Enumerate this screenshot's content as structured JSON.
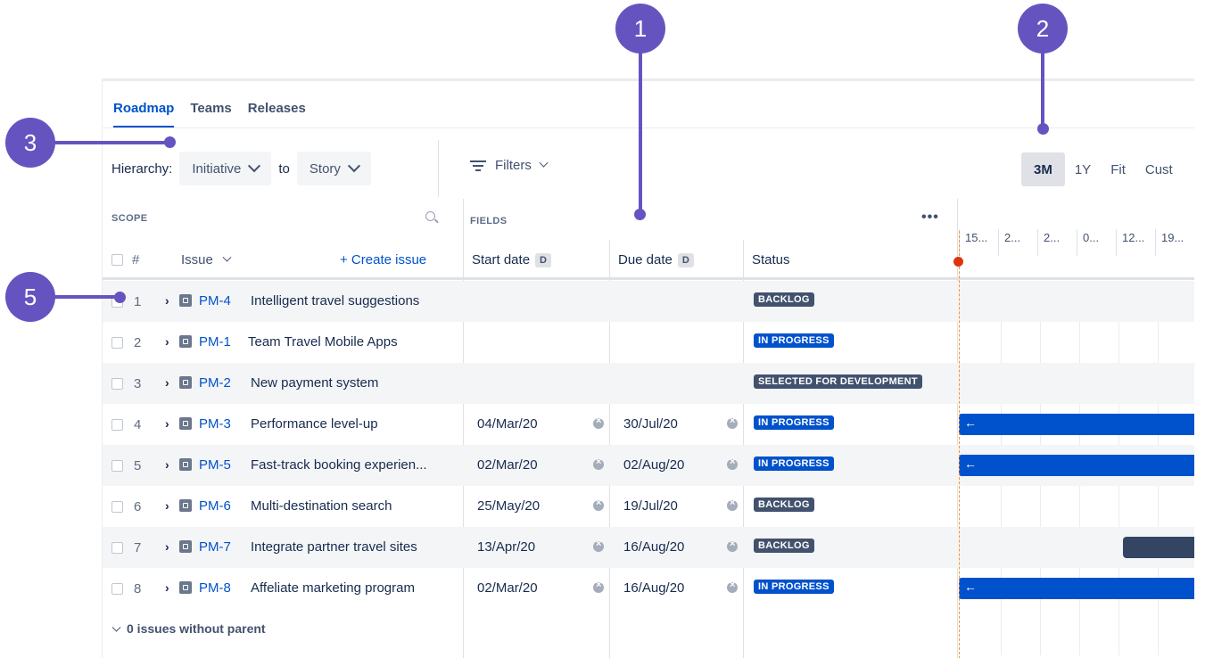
{
  "tabs": [
    {
      "label": "Roadmap"
    },
    {
      "label": "Teams"
    },
    {
      "label": "Releases"
    }
  ],
  "toolbar": {
    "hierarchy_label": "Hierarchy:",
    "from_value": "Initiative",
    "to_label": "to",
    "to_value": "Story",
    "filters_label": "Filters",
    "zoom": [
      "3M",
      "1Y",
      "Fit",
      "Cust"
    ]
  },
  "scope_header": "SCOPE",
  "fields_header": "FIELDS",
  "columns": {
    "hash": "#",
    "issue": "Issue",
    "create": "+ Create issue",
    "start": "Start date",
    "due": "Due date",
    "status": "Status",
    "date_badge": "D"
  },
  "timeline_ticks": [
    "15...",
    "2...",
    "2...",
    "0...",
    "12...",
    "19..."
  ],
  "rows": [
    {
      "n": "1",
      "key": "PM-4",
      "summary": "Intelligent travel suggestions",
      "start": "",
      "due": "",
      "status": "BACKLOG"
    },
    {
      "n": "2",
      "key": "PM-1",
      "summary": "Team Travel Mobile Apps",
      "start": "",
      "due": "",
      "status": "IN PROGRESS"
    },
    {
      "n": "3",
      "key": "PM-2",
      "summary": "New payment system",
      "start": "",
      "due": "",
      "status": "SELECTED FOR DEVELOPMENT"
    },
    {
      "n": "4",
      "key": "PM-3",
      "summary": "Performance level-up",
      "start": "04/Mar/20",
      "due": "30/Jul/20",
      "status": "IN PROGRESS"
    },
    {
      "n": "5",
      "key": "PM-5",
      "summary": "Fast-track booking experien...",
      "start": "02/Mar/20",
      "due": "02/Aug/20",
      "status": "IN PROGRESS"
    },
    {
      "n": "6",
      "key": "PM-6",
      "summary": "Multi-destination search",
      "start": "25/May/20",
      "due": "19/Jul/20",
      "status": "BACKLOG"
    },
    {
      "n": "7",
      "key": "PM-7",
      "summary": "Integrate partner travel sites",
      "start": "13/Apr/20",
      "due": "16/Aug/20",
      "status": "BACKLOG"
    },
    {
      "n": "8",
      "key": "PM-8",
      "summary": "Affeliate marketing program",
      "start": "02/Mar/20",
      "due": "16/Aug/20",
      "status": "IN PROGRESS"
    }
  ],
  "no_parent": "0 issues without parent",
  "callouts": [
    "1",
    "2",
    "3",
    "5"
  ],
  "colors": {
    "accent": "#0052cc",
    "callout": "#6554c0",
    "bar_dark": "#344563",
    "today": "#f79232"
  }
}
